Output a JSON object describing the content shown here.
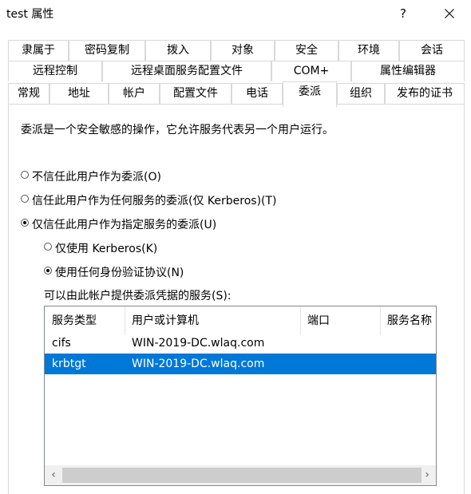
{
  "window": {
    "title": "test 属性",
    "help_label": "?"
  },
  "tabs": {
    "row1": [
      "隶属于",
      "密码复制",
      "拨入",
      "对象",
      "安全",
      "环境",
      "会话"
    ],
    "row2": [
      "远程控制",
      "远程桌面服务配置文件",
      "COM+",
      "属性编辑器"
    ],
    "row3": [
      "常规",
      "地址",
      "帐户",
      "配置文件",
      "电话",
      "委派",
      "组织",
      "发布的证书"
    ],
    "active": "委派"
  },
  "delegation": {
    "description": "委派是一个安全敏感的操作，它允许服务代表另一个用户运行。",
    "option_no_trust": "不信任此用户作为委派(O)",
    "option_trust_any": "信任此用户作为任何服务的委派(仅 Kerberos)(T)",
    "option_trust_specified": "仅信任此用户作为指定服务的委派(U)",
    "sub_kerberos_only": "仅使用 Kerberos(K)",
    "sub_any_protocol": "使用任何身份验证协议(N)",
    "services_label": "可以由此帐户提供委派凭据的服务(S):",
    "selected_option": "option_trust_specified",
    "selected_sub_option": "sub_any_protocol"
  },
  "services_list": {
    "columns": [
      "服务类型",
      "用户或计算机",
      "端口",
      "服务名称"
    ],
    "rows": [
      {
        "type": "cifs",
        "host": "WIN-2019-DC.wlaq.com",
        "port": "",
        "name": ""
      },
      {
        "type": "krbtgt",
        "host": "WIN-2019-DC.wlaq.com",
        "port": "",
        "name": ""
      }
    ],
    "selected_row": 1,
    "scroll_left_label": "‹",
    "scroll_right_label": "›",
    "selection_color": "#0078d7"
  }
}
